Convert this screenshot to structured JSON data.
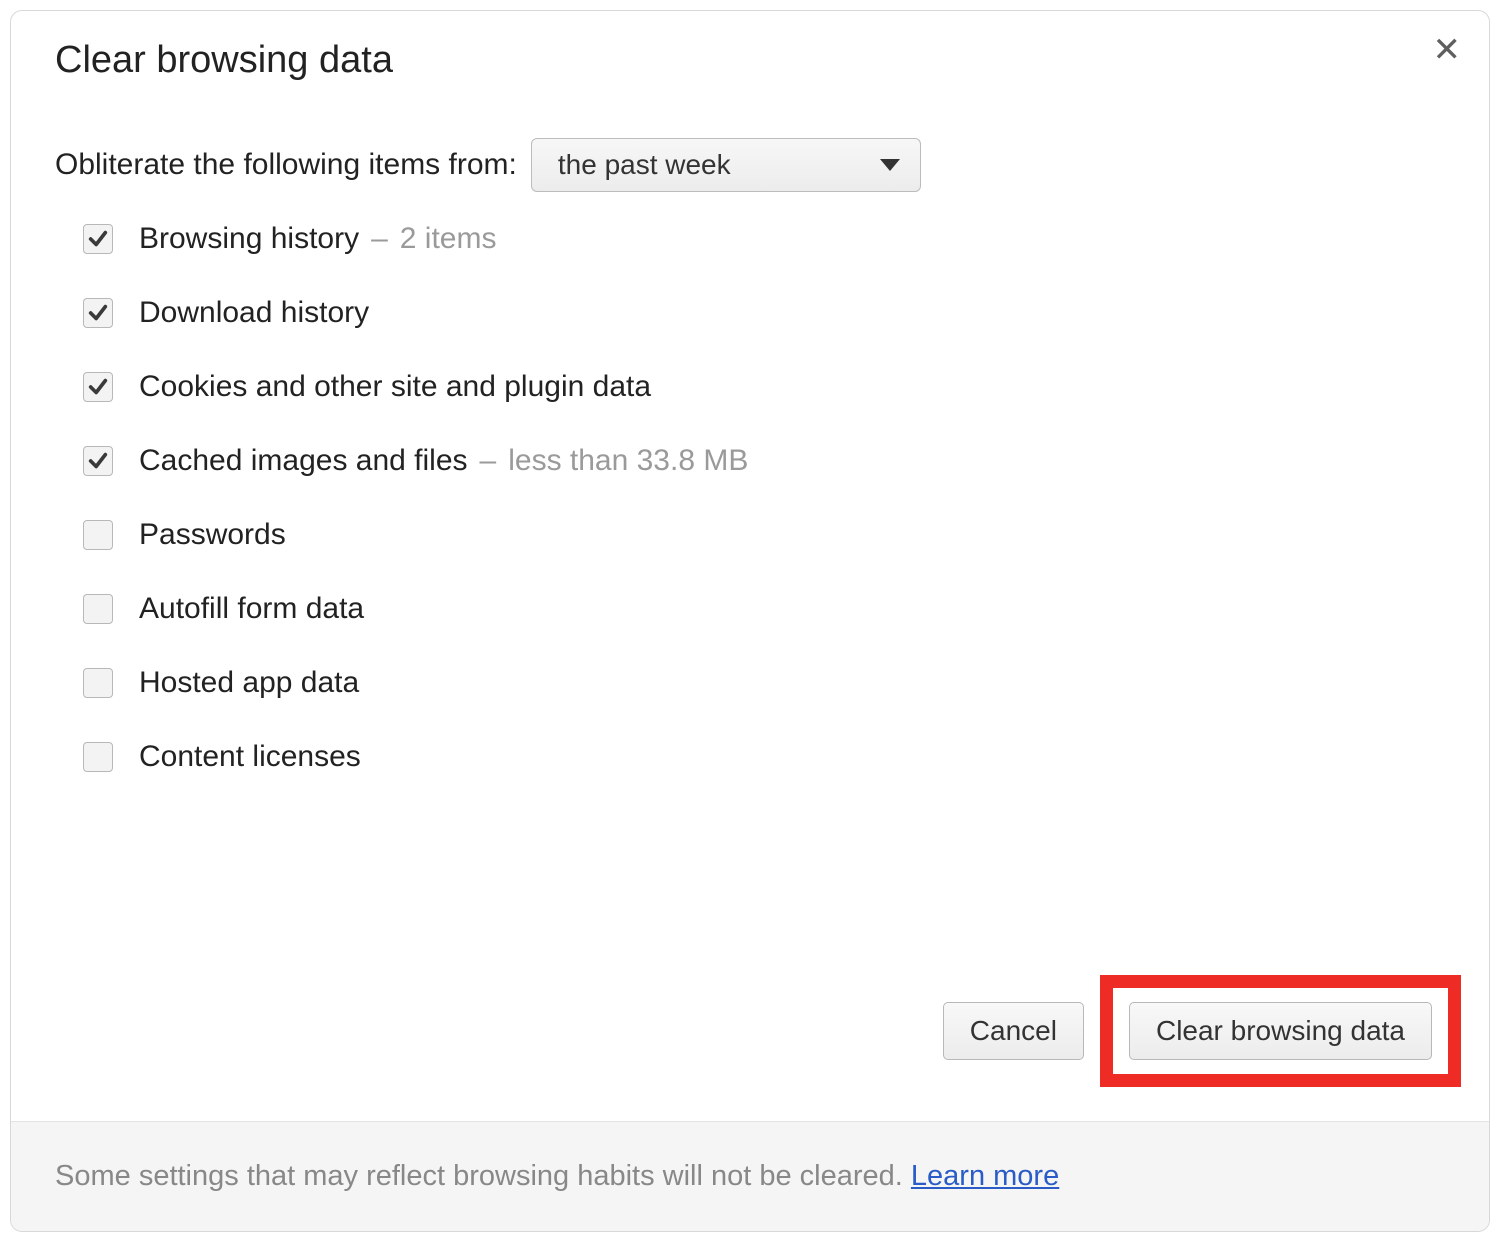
{
  "dialog": {
    "title": "Clear browsing data",
    "range_label": "Obliterate the following items from:",
    "range_value": "the past week",
    "options": [
      {
        "label": "Browsing history",
        "checked": true,
        "detail": "2 items"
      },
      {
        "label": "Download history",
        "checked": true,
        "detail": ""
      },
      {
        "label": "Cookies and other site and plugin data",
        "checked": true,
        "detail": ""
      },
      {
        "label": "Cached images and files",
        "checked": true,
        "detail": "less than 33.8 MB"
      },
      {
        "label": "Passwords",
        "checked": false,
        "detail": ""
      },
      {
        "label": "Autofill form data",
        "checked": false,
        "detail": ""
      },
      {
        "label": "Hosted app data",
        "checked": false,
        "detail": ""
      },
      {
        "label": "Content licenses",
        "checked": false,
        "detail": ""
      }
    ],
    "cancel_label": "Cancel",
    "clear_label": "Clear browsing data",
    "footer_text": "Some settings that may reflect browsing habits will not be cleared. ",
    "learn_more": "Learn more",
    "separator": "–"
  }
}
